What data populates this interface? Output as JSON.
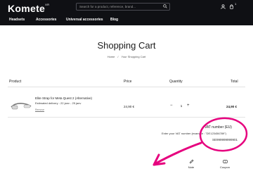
{
  "header": {
    "brand": "Komete",
    "brand_sup": "XR",
    "search_placeholder": "Search for a product, reference, brand...",
    "cart_count": "1",
    "nav": [
      "Headsets",
      "Accessories",
      "Universal accessories",
      "Blog"
    ]
  },
  "page": {
    "title": "Shopping Cart",
    "breadcrumb": [
      "Home",
      "/",
      "Your Shopping Cart"
    ]
  },
  "cart": {
    "columns": [
      "Product",
      "Price",
      "Quantity",
      "Total"
    ],
    "items": [
      {
        "name": "Elite Strap for Meta Quest 2 (Alternative)",
        "delivery": "Estimated delivery : 22 janv - 25 janv",
        "remove": "Remove",
        "price": "24,90 €",
        "quantity": "1",
        "total": "24,90 €"
      }
    ]
  },
  "vat": {
    "title": "VAT number (EU)",
    "help": "Enter your VAT number (example : \"DE123456789\")",
    "value": "SE999999999901"
  },
  "actions": {
    "note": "Note",
    "coupon": "Coupon"
  },
  "colors": {
    "header_bg": "#0f1014",
    "annotation": "#e6007e"
  }
}
